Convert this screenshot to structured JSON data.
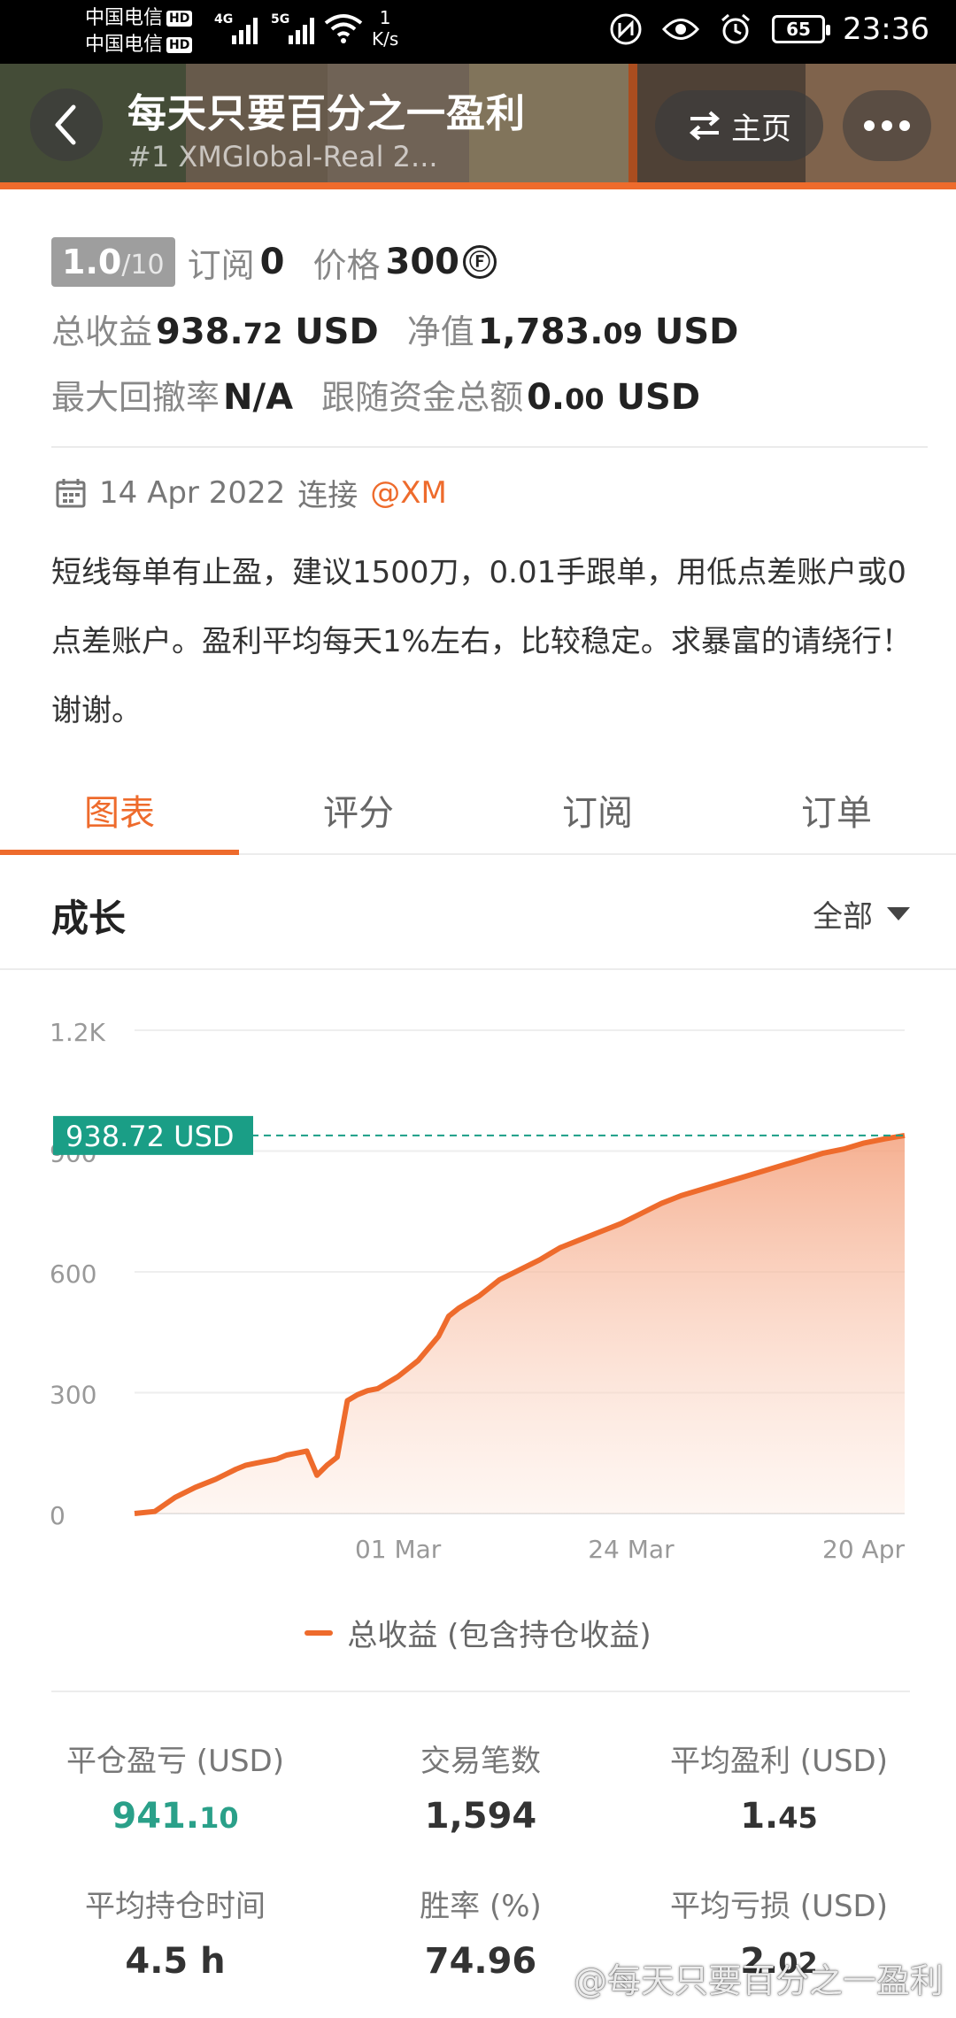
{
  "status_bar": {
    "carrier1": "中国电信",
    "carrier2": "中国电信",
    "hd": "HD",
    "net1": "4G",
    "net2": "5G",
    "speed_value": "1",
    "speed_unit": "K/s",
    "battery": "65",
    "time": "23:36"
  },
  "header": {
    "title": "每天只要百分之一盈利",
    "subtitle": "#1  XMGlobal-Real 2...",
    "home_label": "主页",
    "accent": "#ee6b2c"
  },
  "info": {
    "rating_value": "1.0",
    "rating_max": "/10",
    "subscribe_label": "订阅",
    "subscribe_value": "0",
    "price_label": "价格",
    "price_value": "300",
    "price_icon": "Ⓕ",
    "total_profit_label": "总收益",
    "total_profit_int": "938.",
    "total_profit_dec": "72",
    "total_profit_unit": "USD",
    "equity_label": "净值",
    "equity_int": "1,783.",
    "equity_dec": "09",
    "equity_unit": "USD",
    "drawdown_label": "最大回撤率",
    "drawdown_value": "N/A",
    "follow_funds_label": "跟随资金总额",
    "follow_funds_int": "0.",
    "follow_funds_dec": "00",
    "follow_funds_unit": "USD"
  },
  "connection": {
    "date": "14 Apr 2022",
    "connect_label": "连接",
    "broker": "@XM"
  },
  "description": "短线每单有止盈，建议1500刀，0.01手跟单，用低点差账户或0点差账户。盈利平均每天1%左右，比较稳定。求暴富的请绕行！谢谢。",
  "tabs": [
    {
      "label": "图表",
      "active": true
    },
    {
      "label": "评分",
      "active": false
    },
    {
      "label": "订阅",
      "active": false
    },
    {
      "label": "订单",
      "active": false
    }
  ],
  "section": {
    "title": "成长",
    "filter_label": "全部"
  },
  "chart_data": {
    "type": "area",
    "title": "",
    "xlabel": "",
    "ylabel": "",
    "ylim": [
      0,
      1200
    ],
    "y_ticks": [
      "0",
      "300",
      "600",
      "900",
      "1.2K"
    ],
    "y_tick_values": [
      0,
      300,
      600,
      900,
      1200
    ],
    "x_tick_labels": [
      "01 Mar",
      "24 Mar",
      "20 Apr"
    ],
    "x_tick_values": [
      26,
      49,
      76
    ],
    "x_range": [
      0,
      76
    ],
    "current_label": "938.72 USD",
    "current_value": 938.72,
    "series": [
      {
        "name": "总收益 (包含持仓收益)",
        "color": "#ee6b2c",
        "x": [
          0,
          2,
          4,
          6,
          8,
          10,
          11,
          12,
          14,
          15,
          16,
          17,
          18,
          19,
          20,
          21,
          22,
          23,
          24,
          26,
          28,
          30,
          31,
          32,
          33,
          34,
          35,
          36,
          38,
          40,
          41,
          42,
          44,
          46,
          48,
          50,
          52,
          54,
          56,
          58,
          60,
          62,
          64,
          66,
          68,
          70,
          72,
          74,
          76
        ],
        "values": [
          0,
          5,
          40,
          65,
          85,
          110,
          120,
          125,
          135,
          145,
          150,
          155,
          95,
          120,
          140,
          280,
          295,
          305,
          310,
          340,
          380,
          440,
          490,
          510,
          525,
          540,
          560,
          580,
          605,
          630,
          645,
          660,
          680,
          700,
          720,
          745,
          770,
          790,
          805,
          820,
          835,
          850,
          865,
          880,
          895,
          905,
          920,
          930,
          938.72
        ]
      }
    ],
    "grid": true,
    "legend_position": "bottom"
  },
  "stats": [
    {
      "label": "平仓盈亏 (USD)",
      "value_int": "941.",
      "value_dec": "10",
      "green": true
    },
    {
      "label": "交易笔数",
      "value_int": "1,594",
      "value_dec": "",
      "green": false
    },
    {
      "label": "平均盈利 (USD)",
      "value_int": "1.",
      "value_dec": "45",
      "green": false
    },
    {
      "label": "平均持仓时间",
      "value_int": "4.5 h",
      "value_dec": "",
      "green": false
    },
    {
      "label": "胜率 (%)",
      "value_int": "74.96",
      "value_dec": "",
      "green": false
    },
    {
      "label": "平均亏损 (USD)",
      "value_int": "2.",
      "value_dec": "02",
      "green": false
    }
  ],
  "watermark": "@每天只要百分之一盈利"
}
